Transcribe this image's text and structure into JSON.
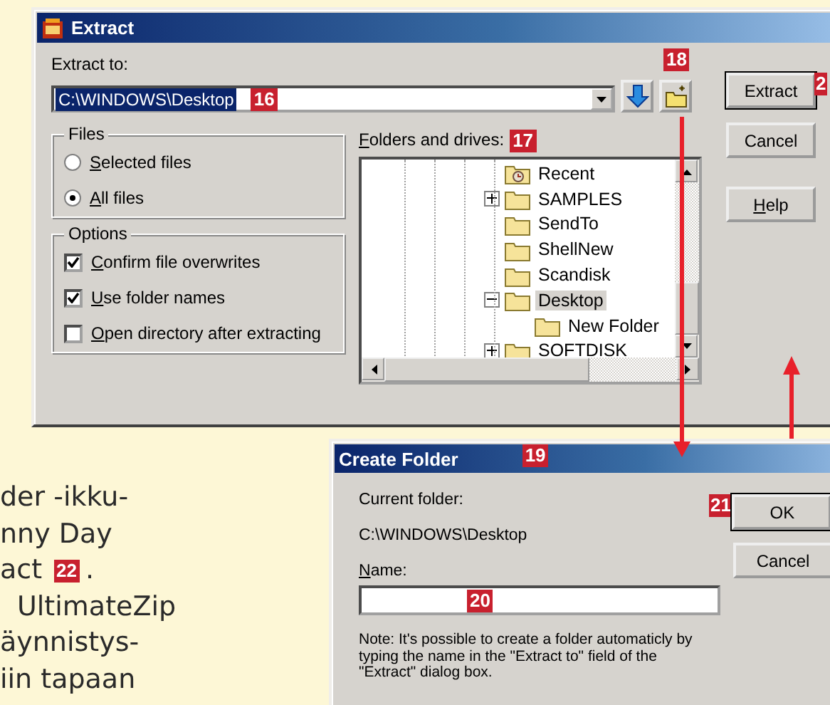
{
  "article_lines": [
    {
      "text": "der -ikku-"
    },
    {
      "text": "nny Day"
    },
    {
      "text": "act",
      "callout": "22",
      "after": "."
    },
    {
      "text": "UltimateZip"
    },
    {
      "text": "äynnistys-"
    },
    {
      "text": "iin tapaan"
    }
  ],
  "extract_dialog": {
    "title": "Extract",
    "extract_to_label": "Extract to:",
    "path": {
      "value": "C:\\WINDOWS\\Desktop",
      "text_selected": true,
      "callout": "16"
    },
    "new_folder_callout": "18",
    "files_group": {
      "title": "Files",
      "options": [
        {
          "label": "Selected files",
          "selected": false
        },
        {
          "label": "All files",
          "selected": true
        }
      ]
    },
    "options_group": {
      "title": "Options",
      "options": [
        {
          "label": "Confirm file overwrites",
          "checked": true
        },
        {
          "label": "Use folder names",
          "checked": true
        },
        {
          "label": "Open directory after extracting",
          "checked": false
        }
      ]
    },
    "folders_label": {
      "text": "Folders and drives:",
      "callout": "17"
    },
    "tree": [
      {
        "label": "Recent",
        "kind": "special",
        "selected": false
      },
      {
        "label": "SAMPLES",
        "kind": "folder",
        "expanded": false,
        "selected": false
      },
      {
        "label": "SendTo",
        "kind": "folder",
        "selected": false
      },
      {
        "label": "ShellNew",
        "kind": "folder",
        "selected": false
      },
      {
        "label": "Scandisk",
        "kind": "folder",
        "selected": false
      },
      {
        "label": "Desktop",
        "kind": "folder",
        "expanded": true,
        "selected": true,
        "children": [
          {
            "label": "New Folder",
            "kind": "folder",
            "selected": false
          }
        ]
      },
      {
        "label": "SOFTDISK",
        "kind": "folder",
        "expanded": false,
        "selected": false
      }
    ],
    "buttons": [
      {
        "label": "Extract",
        "default": true,
        "callout": "2"
      },
      {
        "label": "Cancel",
        "default": false
      },
      {
        "label": "Help",
        "default": false
      }
    ]
  },
  "create_folder_dialog": {
    "title": "Create Folder",
    "title_callout": "19",
    "current_folder_label": "Current folder:",
    "current_folder": "C:\\WINDOWS\\Desktop",
    "name_label": "Name:",
    "name_callout": "20",
    "note": "Note: It's possible to create a folder automaticly by typing the name in the \"Extract to\" field of the \"Extract\" dialog box.",
    "buttons": [
      {
        "label": "OK",
        "default": true,
        "callout": "21"
      },
      {
        "label": "Cancel",
        "default": false
      }
    ]
  }
}
